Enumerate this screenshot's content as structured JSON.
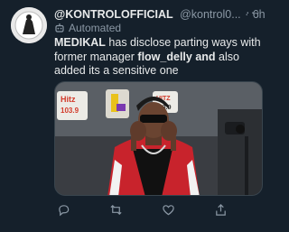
{
  "tweet": {
    "display_name": "@KONTROLOFFICIAL",
    "handle": "@kontrol0...",
    "separator": "·",
    "time": "6h",
    "automated_label": "Automated",
    "text_part1": "MEDIKAL",
    "text_part2": " has disclose parting ways with former manager ",
    "text_part3": "flow_delly",
    "text_part4": " ",
    "text_part5": "and",
    "text_part6": " also added its a sensitive one",
    "media": {
      "sign_left": "Hitz",
      "sign_left_sub": "103.9",
      "sign_right": "HITZ",
      "sign_right_sub": "103.9"
    }
  },
  "icons": [
    "more-icon",
    "bot-icon",
    "reply-icon",
    "retweet-icon",
    "like-icon",
    "share-icon"
  ],
  "colors": {
    "background": "#15202b",
    "text": "#e7e9ea",
    "muted": "#8b98a5",
    "jacket": "#c8232c"
  }
}
